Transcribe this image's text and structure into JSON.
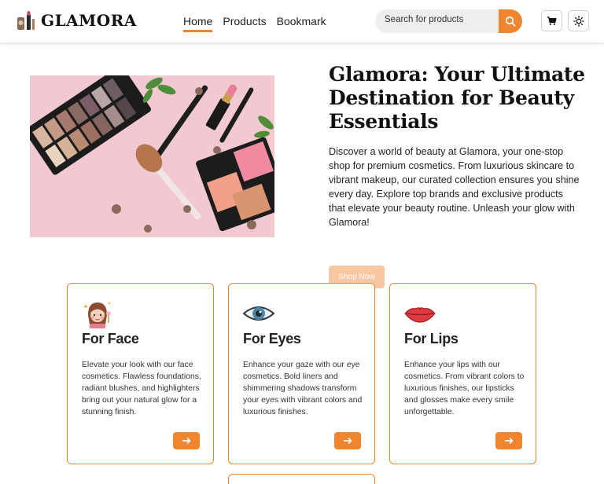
{
  "header": {
    "logo_text": "GLAMORA",
    "nav": [
      {
        "label": "Home",
        "active": true
      },
      {
        "label": "Products",
        "active": false
      },
      {
        "label": "Bookmark",
        "active": false
      }
    ],
    "search": {
      "placeholder": "Search for products",
      "value": ""
    },
    "icons": [
      "search-icon",
      "cart-icon",
      "sun-icon"
    ]
  },
  "hero": {
    "title": "Glamora: Your Ultimate Destination for Beauty Essentials",
    "description": "Discover a world of beauty at Glamora, your one-stop shop for premium cosmetics. From luxurious skincare to vibrant makeup, our curated collection ensures you shine every day. Explore top brands and exclusive products that elevate your beauty routine. Unleash your glow with Glamora!",
    "cta": "Shop Now"
  },
  "categories": [
    {
      "title": "For Face",
      "icon": "face-makeup-icon",
      "text": "Elevate your look with our face cosmetics. Flawless foundations, radiant blushes, and highlighters bring out your natural glow for a stunning finish."
    },
    {
      "title": "For Eyes",
      "icon": "eye-icon",
      "text": "Enhance your gaze with our eye cosmetics. Bold liners and shimmering shadows transform your eyes with vibrant colors and luxurious finishes."
    },
    {
      "title": "For Lips",
      "icon": "lips-icon",
      "text": "Enhance your lips with our cosmetics. From vibrant colors to luxurious finishes, our lipsticks and glosses make every smile unforgettable."
    }
  ],
  "colors": {
    "accent": "#f0852d",
    "accent_light": "#f8c6a0",
    "hero_bg": "#f2c6cf"
  }
}
